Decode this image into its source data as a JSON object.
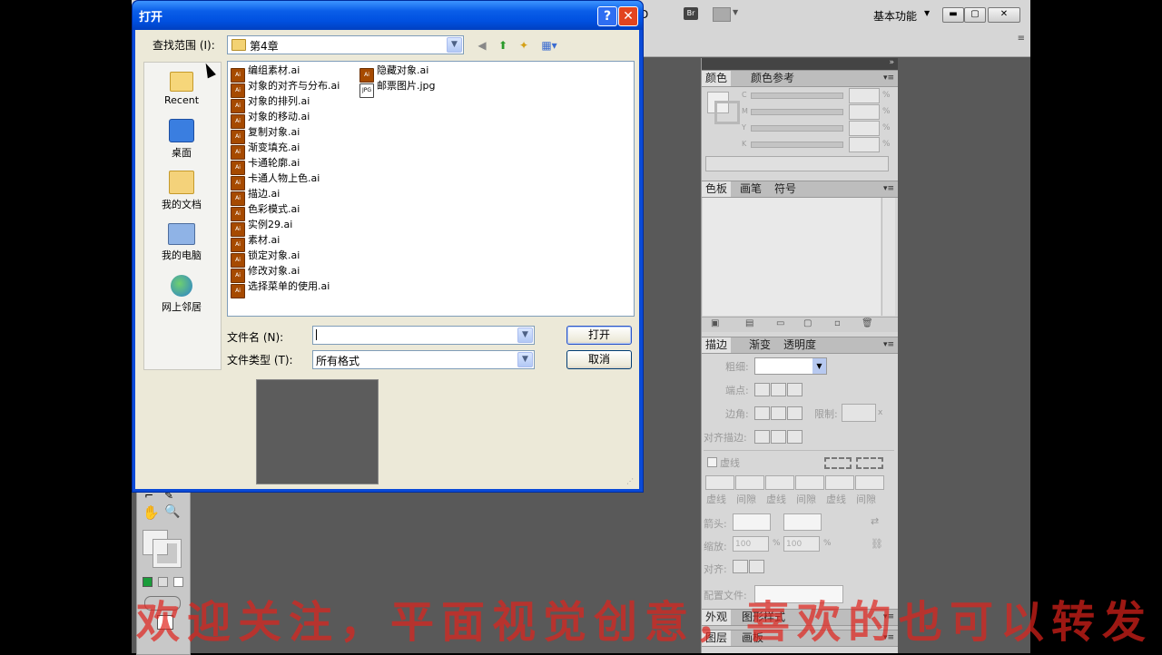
{
  "app": {
    "workspace_label": "基本功能",
    "br_label": "Br",
    "partial_label": "D",
    "panels": {
      "color": {
        "tabs": [
          "颜色",
          "颜色参考"
        ],
        "channels": [
          "C",
          "M",
          "Y",
          "K"
        ],
        "percent": "%"
      },
      "swatches": {
        "tabs": [
          "色板",
          "画笔",
          "符号"
        ]
      },
      "stroke": {
        "tabs": [
          "描边",
          "渐变",
          "透明度"
        ],
        "weight_label": "粗细:",
        "cap_label": "端点:",
        "corner_label": "边角:",
        "limit_label": "限制:",
        "limit_unit": "x",
        "align_label": "对齐描边:",
        "dashed_label": "虚线",
        "dash_labels": [
          "虚线",
          "间隙",
          "虚线",
          "间隙",
          "虚线",
          "间隙"
        ],
        "arrow_label": "箭头:",
        "scale_label": "缩放:",
        "scale_values": [
          "100",
          "100"
        ],
        "scale_unit": "%",
        "align2_label": "对齐:",
        "profile_label": "配置文件:"
      },
      "appearance": {
        "tabs": [
          "外观",
          "图形样式"
        ]
      },
      "layers": {
        "tabs": [
          "图层",
          "画板"
        ]
      }
    }
  },
  "dialog": {
    "title": "打开",
    "help_btn": "?",
    "close_btn": "✕",
    "lookin_label": "查找范围 (I):",
    "lookin_value": "第4章",
    "places": [
      "Recent",
      "桌面",
      "我的文档",
      "我的电脑",
      "网上邻居"
    ],
    "files_col1": [
      "编组素材.ai",
      "对象的对齐与分布.ai",
      "对象的排列.ai",
      "对象的移动.ai",
      "复制对象.ai",
      "渐变填充.ai",
      "卡通轮廓.ai",
      "卡通人物上色.ai",
      "描边.ai",
      "色彩模式.ai",
      "实例29.ai",
      "素材.ai",
      "锁定对象.ai",
      "修改对象.ai",
      "选择菜单的使用.ai"
    ],
    "files_col2": [
      "隐藏对象.ai",
      "邮票图片.jpg"
    ],
    "filename_label": "文件名 (N):",
    "filename_value": "",
    "filetype_label": "文件类型 (T):",
    "filetype_value": "所有格式",
    "open_btn": "打开",
    "cancel_btn": "取消"
  },
  "watermark": "欢迎关注，平面视觉创意，喜欢的也可以转发"
}
